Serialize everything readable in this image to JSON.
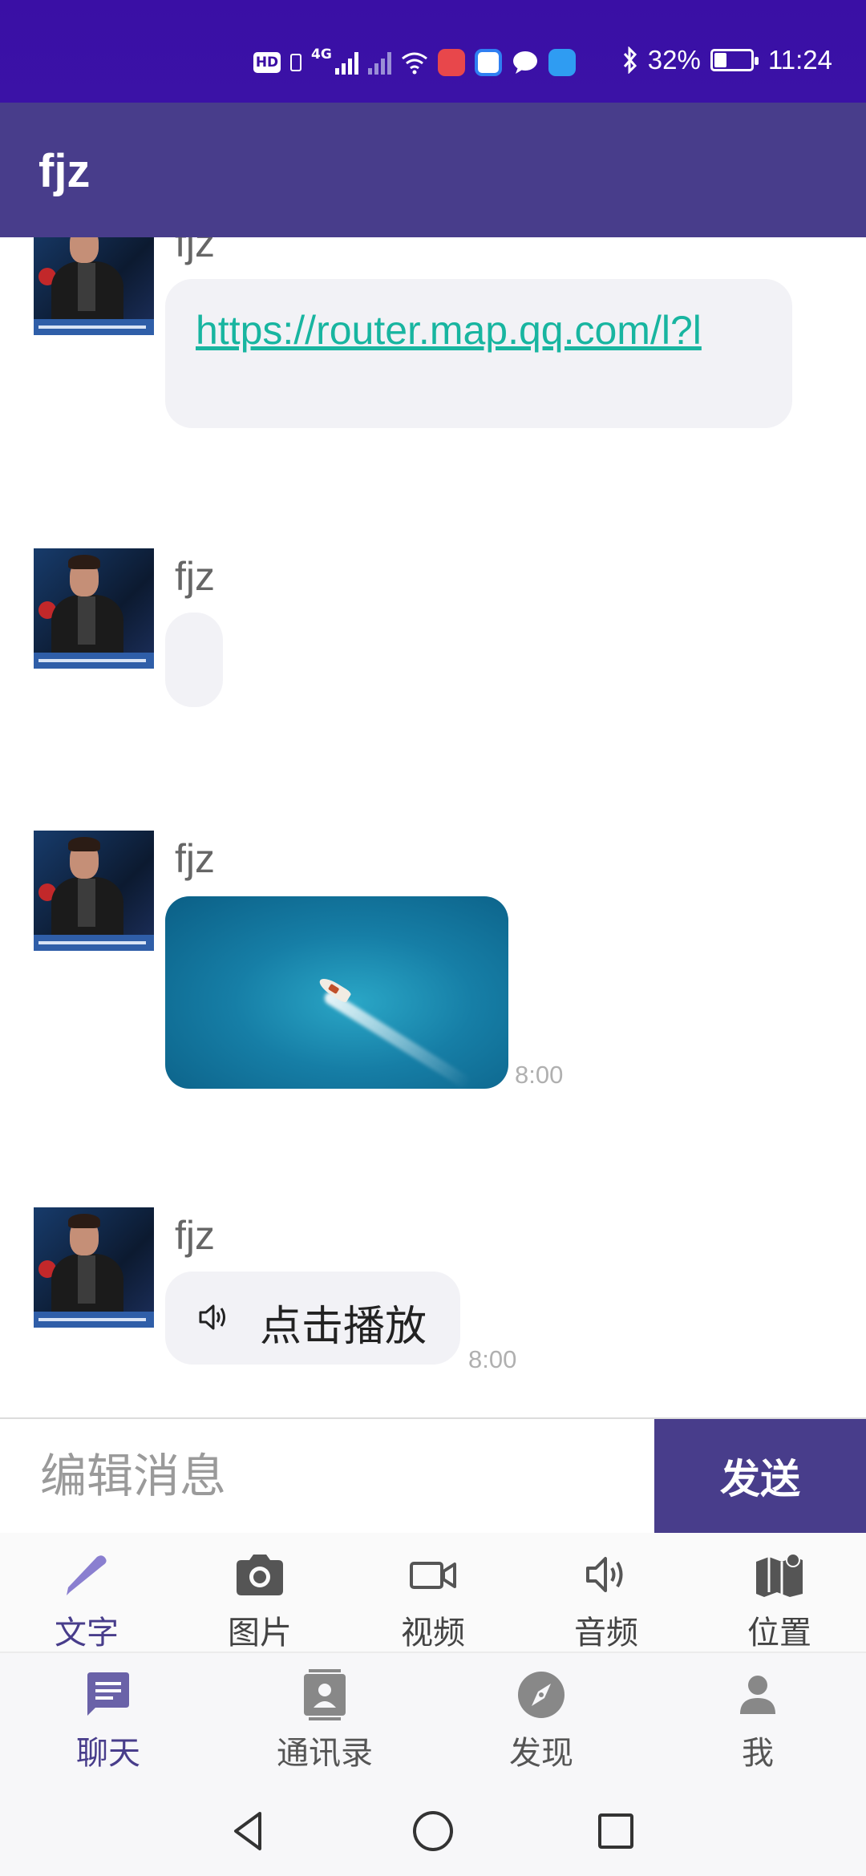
{
  "status_bar": {
    "hd_label": "HD",
    "network_label": "4G",
    "battery_text": "32%",
    "battery_level": 0.32,
    "time": "11:24"
  },
  "app_bar": {
    "title": "fjz"
  },
  "messages": [
    {
      "type": "link",
      "sender": "fjz",
      "text": "https://router.map.qq.com/l?l"
    },
    {
      "type": "text",
      "sender": "fjz",
      "text": ""
    },
    {
      "type": "image",
      "sender": "fjz",
      "time": "8:00"
    },
    {
      "type": "voice",
      "sender": "fjz",
      "label": "点击播放",
      "time": "8:00"
    }
  ],
  "composer": {
    "placeholder": "编辑消息",
    "send_label": "发送"
  },
  "message_types": [
    {
      "label": "文字",
      "icon": "pencil-icon",
      "active": true
    },
    {
      "label": "图片",
      "icon": "camera-icon"
    },
    {
      "label": "视频",
      "icon": "video-camera-icon"
    },
    {
      "label": "音频",
      "icon": "speaker-icon"
    },
    {
      "label": "位置",
      "icon": "map-icon"
    }
  ],
  "bottom_nav": [
    {
      "label": "聊天",
      "icon": "chat-icon",
      "active": true
    },
    {
      "label": "通讯录",
      "icon": "contacts-icon"
    },
    {
      "label": "发现",
      "icon": "compass-icon"
    },
    {
      "label": "我",
      "icon": "person-icon"
    }
  ],
  "colors": {
    "status_bar": "#3a0ca3",
    "primary": "#483d8b",
    "link": "#18b5a0",
    "bubble": "#f2f2f6"
  }
}
